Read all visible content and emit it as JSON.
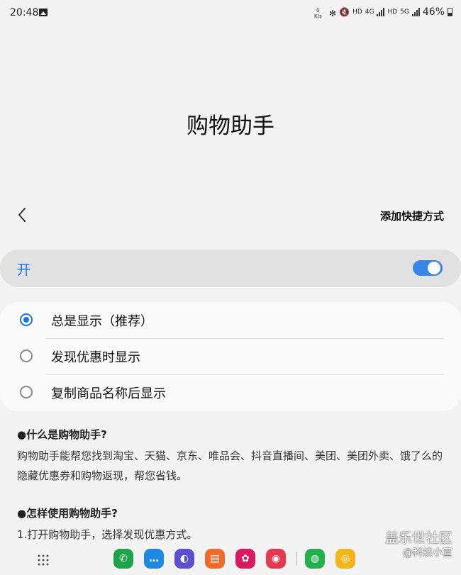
{
  "status_bar": {
    "time": "20:48",
    "speed_value": "0",
    "speed_unit": "K/s",
    "network_1": "HD",
    "network_2": "4G",
    "network_3": "HD",
    "network_4": "5G",
    "battery": "46%"
  },
  "page": {
    "title": "购物助手",
    "shortcut_label": "添加快捷方式"
  },
  "toggle": {
    "label": "开",
    "state": "on",
    "accent": "#3a86e8"
  },
  "options": [
    {
      "label": "总是显示（推荐）",
      "selected": true
    },
    {
      "label": "发现优惠时显示",
      "selected": false
    },
    {
      "label": "复制商品名称后显示",
      "selected": false
    }
  ],
  "help": {
    "q1": "●什么是购物助手?",
    "a1": "购物助手能帮您找到淘宝、天猫、京东、唯品会、抖音直播间、美团、美团外卖、饿了么的隐藏优惠券和购物返现，帮您省钱。",
    "q2": "●怎样使用购物助手?",
    "a2": "1.打开购物助手，选择发现优惠方式。"
  },
  "dock": {
    "apps": [
      {
        "name": "phone-app-icon",
        "color": "#1fa34a",
        "glyph": "✆"
      },
      {
        "name": "messages-app-icon",
        "color": "#1e88e5",
        "glyph": "…"
      },
      {
        "name": "internet-app-icon",
        "color": "#5b4fcf",
        "glyph": "◐"
      },
      {
        "name": "notes-app-icon",
        "color": "#f06a2c",
        "glyph": "▤"
      },
      {
        "name": "gallery-app-icon",
        "color": "#d81b60",
        "glyph": "✿"
      },
      {
        "name": "camera-app-icon",
        "color": "#e53950",
        "glyph": "◉"
      },
      {
        "name": "wechat-app-icon",
        "color": "#22b14c",
        "glyph": "◍"
      },
      {
        "name": "weibo-app-icon",
        "color": "#f2b51c",
        "glyph": "◎"
      }
    ]
  },
  "watermark": {
    "main": "盖乐世社区",
    "sub": "@科技小宣"
  }
}
